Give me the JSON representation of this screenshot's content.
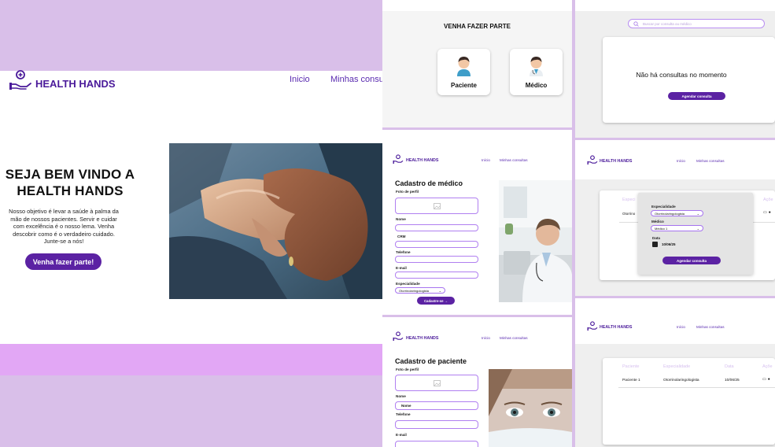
{
  "colors": {
    "brand": "#4a1a9a",
    "accent": "#5b22a3",
    "background": "#d9bfe9",
    "footer": "#e2a7f5"
  },
  "brand": {
    "name": "HEALTH HANDS"
  },
  "landing": {
    "nav": {
      "home": "Inicio",
      "appointments": "Minhas consu"
    },
    "title_line1": "SEJA BEM VINDO A",
    "title_line2": "HEALTH HANDS",
    "text_line1": "Nosso objetivo é levar a saúde à palma da",
    "text_line2": "mão de nossos pacientes. Servir e cuidar",
    "text_line3": "com excelência é o nosso lema. Venha",
    "text_line4": "descobrir como é o verdadeiro cuidado.",
    "text_line5": "Junte-se a nós!",
    "cta": "Venha fazer parte!"
  },
  "choose": {
    "title": "VENHA FAZER PARTE",
    "patient": "Paciente",
    "doctor": "Médico"
  },
  "empty": {
    "search_placeholder": "Buscar por consulta ou médico",
    "message": "Não há consultas no momento",
    "button": "Agendar consulta"
  },
  "small_nav": {
    "home": "Início",
    "appointments": "Minhas consultas"
  },
  "doctor_form": {
    "title": "Cadastro de médico",
    "photo": "Foto de perfil",
    "name": "Nome",
    "crm": "CRM",
    "phone": "Telefone",
    "email": "E-mail",
    "specialty": "Especialidade",
    "specialty_value": "Otorrinolaringologista",
    "submit": "Cadastre-se →"
  },
  "schedule": {
    "bg_col1": "Especi",
    "bg_col_right": "Açõe",
    "bg_row_value": "Otorrino",
    "specialty_label": "Especialidade",
    "specialty_value": "Otorrinolaringologista",
    "doctor_label": "Médico",
    "doctor_value": "Médico 1",
    "date_label": "Data",
    "date_value": "10/06/25",
    "button": "Agendar consulta"
  },
  "patient_form": {
    "title": "Cadastro de paciente",
    "photo": "Foto de perfil",
    "name": "Nome",
    "name_value": "Nome",
    "phone": "Telefone",
    "email": "E-mail"
  },
  "appointments": {
    "headers": [
      "Paciente",
      "Especialidade",
      "Data",
      "Açõe"
    ],
    "row": [
      "Paciente 1",
      "Otorrinolaringologista",
      "10/06/25"
    ]
  }
}
